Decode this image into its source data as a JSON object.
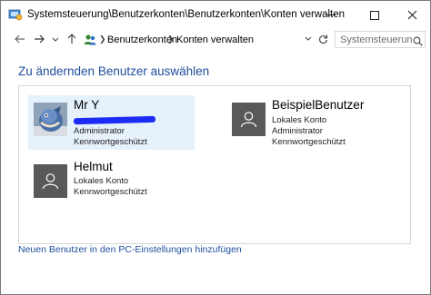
{
  "window": {
    "title": "Systemsteuerung\\Benutzerkonten\\Benutzerkonten\\Konten verwalten"
  },
  "nav": {
    "breadcrumbs": [
      "Benutzerkonten",
      "Konten verwalten"
    ],
    "search_placeholder": "Systemsteuerun..."
  },
  "main": {
    "heading": "Zu ändernden Benutzer auswählen",
    "accounts": [
      {
        "name": "Mr Y",
        "lines": [
          "Administrator",
          "Kennwortgeschützt"
        ],
        "selected": true,
        "avatar": "photo"
      },
      {
        "name": "BeispielBenutzer",
        "lines": [
          "Lokales Konto",
          "Administrator",
          "Kennwortgeschützt"
        ],
        "selected": false,
        "avatar": "default-user-icon"
      },
      {
        "name": "Helmut",
        "lines": [
          "Lokales Konto",
          "Kennwortgeschützt"
        ],
        "selected": false,
        "avatar": "default-user-icon"
      }
    ],
    "footer_link": "Neuen Benutzer in den PC-Einstellungen hinzufügen"
  },
  "colors": {
    "accent": "#1e4e9c",
    "selection": "#e5f1fb",
    "avatar_bg": "#595959",
    "redaction": "#1b2cf5"
  }
}
